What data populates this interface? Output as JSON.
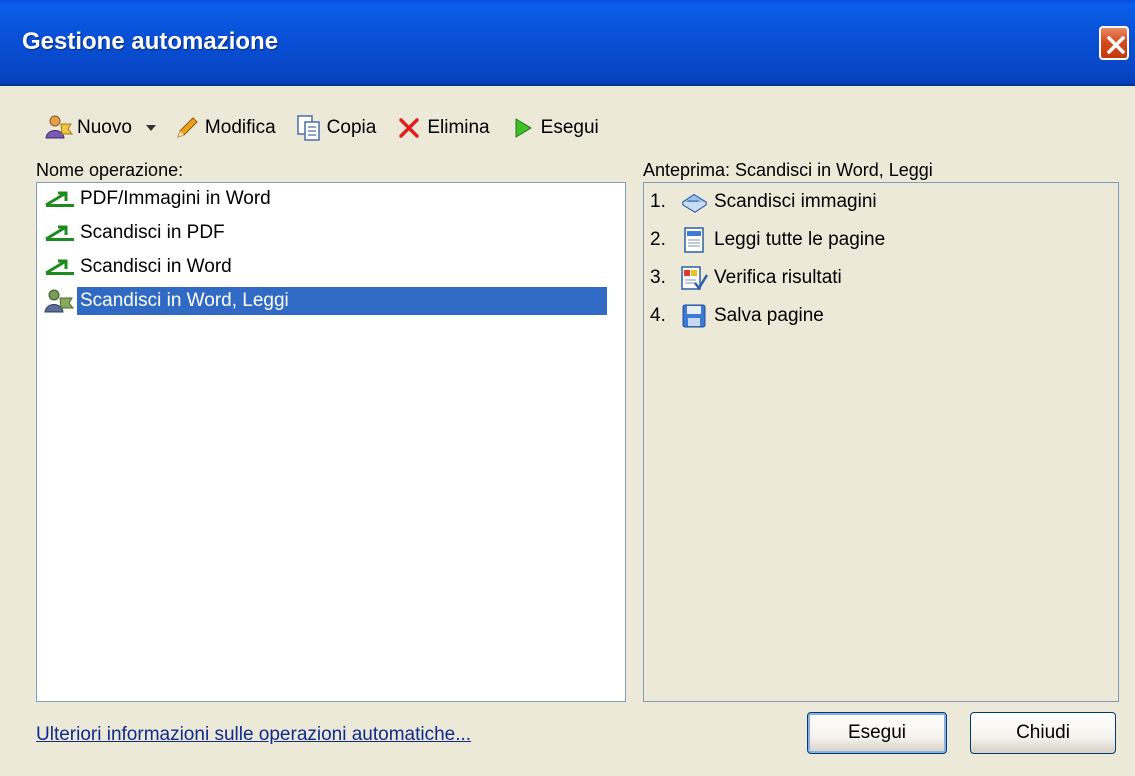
{
  "window": {
    "title": "Gestione automazione"
  },
  "toolbar": {
    "new_label": "Nuovo",
    "edit_label": "Modifica",
    "copy_label": "Copia",
    "delete_label": "Elimina",
    "run_label": "Esegui"
  },
  "left_panel": {
    "label": "Nome operazione:",
    "items": [
      {
        "label": "PDF/Immagini in Word",
        "icon": "green-arrow-icon"
      },
      {
        "label": "Scandisci in PDF",
        "icon": "green-arrow-icon"
      },
      {
        "label": "Scandisci in Word",
        "icon": "green-arrow-icon"
      },
      {
        "label": "Scandisci in Word, Leggi",
        "icon": "custom-task-icon",
        "selected": true
      }
    ]
  },
  "right_panel": {
    "label": "Anteprima: Scandisci in Word, Leggi",
    "steps": [
      {
        "num": "1.",
        "label": "Scandisci immagini",
        "icon": "scanner-icon"
      },
      {
        "num": "2.",
        "label": "Leggi tutte le pagine",
        "icon": "read-page-icon"
      },
      {
        "num": "3.",
        "label": "Verifica risultati",
        "icon": "verify-icon"
      },
      {
        "num": "4.",
        "label": "Salva pagine",
        "icon": "save-icon"
      }
    ]
  },
  "footer": {
    "help_link": "Ulteriori informazioni sulle operazioni automatiche...",
    "run_button": "Esegui",
    "close_button": "Chiudi"
  },
  "colors": {
    "titlebar": "#0a52dc",
    "selection": "#316ac5",
    "dialog_bg": "#ece9d8",
    "link": "#0f2b8c"
  }
}
